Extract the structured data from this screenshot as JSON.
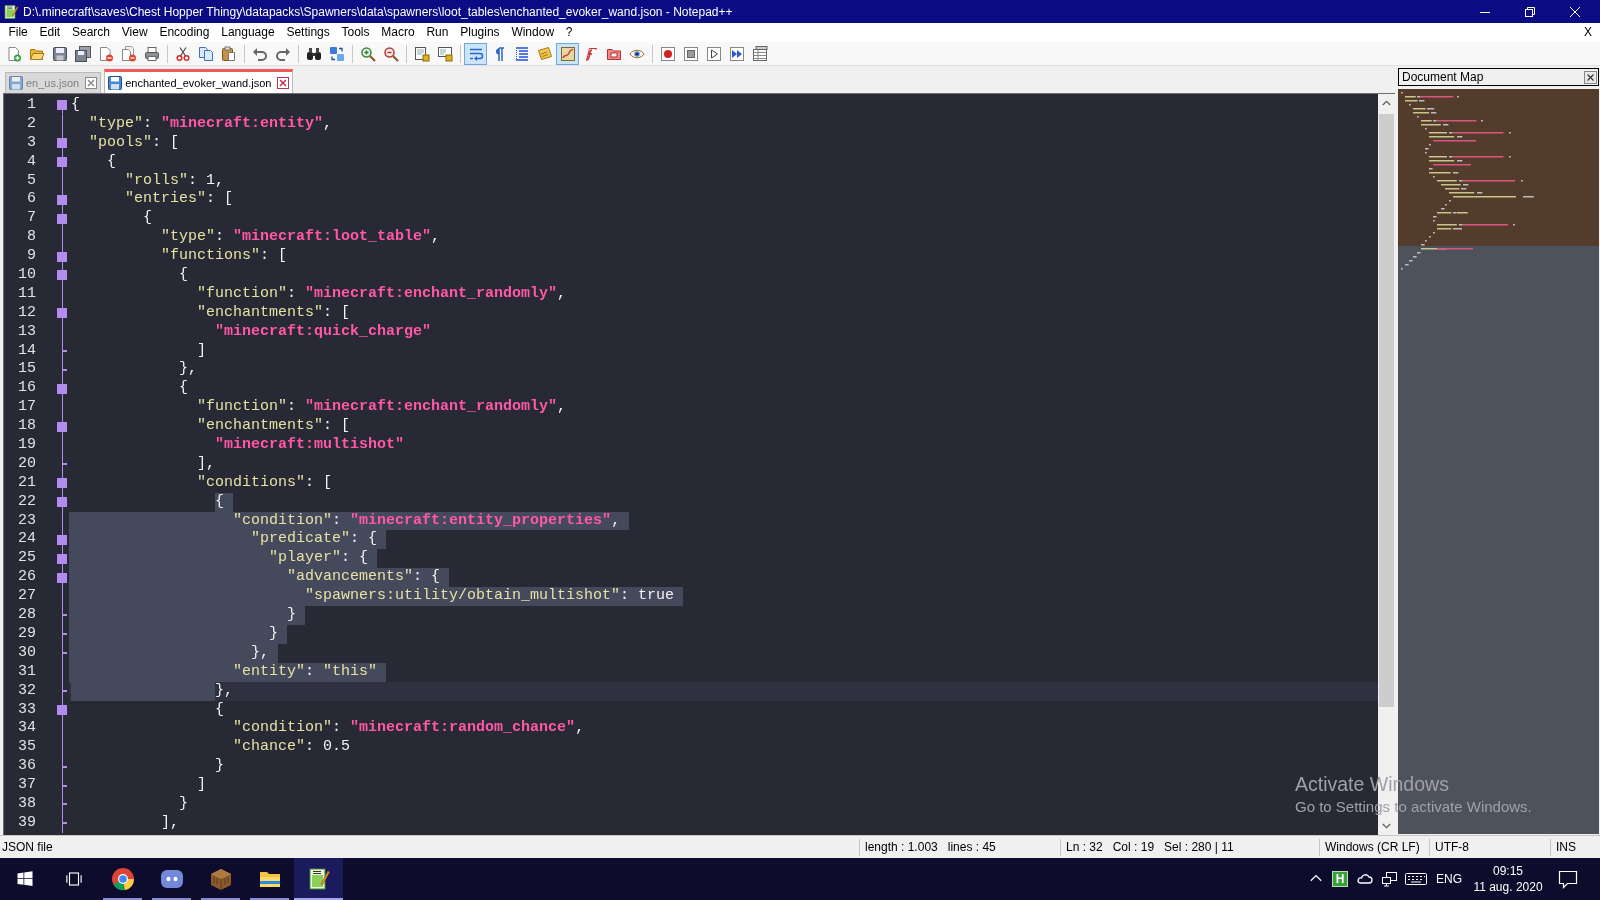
{
  "window": {
    "title": "D:\\.minecraft\\saves\\Chest Hopper Thingy\\datapacks\\Spawners\\data\\spawners\\loot_tables\\enchanted_evoker_wand.json - Notepad++"
  },
  "menu_bar": {
    "items": [
      "File",
      "Edit",
      "Search",
      "View",
      "Encoding",
      "Language",
      "Settings",
      "Tools",
      "Macro",
      "Run",
      "Plugins",
      "Window",
      "?"
    ],
    "close_glyph": "X"
  },
  "toolbar": {
    "groups": [
      [
        {
          "kind": "new",
          "pressed": false
        },
        {
          "kind": "open",
          "pressed": false
        },
        {
          "kind": "save",
          "pressed": false
        },
        {
          "kind": "saveall",
          "pressed": false
        },
        {
          "kind": "close",
          "pressed": false
        },
        {
          "kind": "closeall",
          "pressed": false
        },
        {
          "kind": "print",
          "pressed": false
        }
      ],
      [
        {
          "kind": "cut",
          "pressed": false
        },
        {
          "kind": "copy",
          "pressed": false
        },
        {
          "kind": "paste",
          "pressed": false
        }
      ],
      [
        {
          "kind": "undo",
          "pressed": false
        },
        {
          "kind": "redo",
          "pressed": false
        }
      ],
      [
        {
          "kind": "find",
          "pressed": false
        },
        {
          "kind": "replace",
          "pressed": false
        }
      ],
      [
        {
          "kind": "zoomin",
          "pressed": false
        },
        {
          "kind": "zoomout",
          "pressed": false
        }
      ],
      [
        {
          "kind": "syncv",
          "pressed": false
        },
        {
          "kind": "synch",
          "pressed": false
        }
      ],
      [
        {
          "kind": "wrap",
          "pressed": true
        },
        {
          "kind": "allchars",
          "pressed": false
        },
        {
          "kind": "indent",
          "pressed": false
        },
        {
          "kind": "udl",
          "pressed": false
        },
        {
          "kind": "docmap",
          "pressed": true
        },
        {
          "kind": "funclist",
          "pressed": false
        },
        {
          "kind": "folder",
          "pressed": false
        },
        {
          "kind": "monitor",
          "pressed": false
        }
      ],
      [
        {
          "kind": "record",
          "pressed": false
        },
        {
          "kind": "stop",
          "pressed": false
        },
        {
          "kind": "play",
          "pressed": false
        },
        {
          "kind": "playmulti",
          "pressed": false
        },
        {
          "kind": "savemacro",
          "pressed": false
        }
      ]
    ]
  },
  "tabs": [
    {
      "label": "en_us.json",
      "selected": false
    },
    {
      "label": "enchanted_evoker_wand.json",
      "selected": true
    }
  ],
  "editor": {
    "lines": [
      {
        "number": "1",
        "kind": "opener",
        "selected": false,
        "indent_selected": false,
        "current": false,
        "segments": [
          {
            "kind": "plain",
            "text": "{"
          }
        ]
      },
      {
        "number": "2",
        "kind": "inner",
        "selected": false,
        "indent_selected": false,
        "current": false,
        "segments": [
          {
            "kind": "string",
            "text": "  \"type\""
          },
          {
            "kind": "plain",
            "text": ": "
          },
          {
            "kind": "constant",
            "text": "\"minecraft:entity\""
          },
          {
            "kind": "plain",
            "text": ","
          }
        ]
      },
      {
        "number": "3",
        "kind": "opener",
        "selected": false,
        "indent_selected": false,
        "current": false,
        "segments": [
          {
            "kind": "string",
            "text": "  \"pools\""
          },
          {
            "kind": "plain",
            "text": ": ["
          }
        ]
      },
      {
        "number": "4",
        "kind": "opener",
        "selected": false,
        "indent_selected": false,
        "current": false,
        "segments": [
          {
            "kind": "plain",
            "text": "    {"
          }
        ]
      },
      {
        "number": "5",
        "kind": "inner",
        "selected": false,
        "indent_selected": false,
        "current": false,
        "segments": [
          {
            "kind": "string",
            "text": "      \"rolls\""
          },
          {
            "kind": "plain",
            "text": ": 1,"
          }
        ]
      },
      {
        "number": "6",
        "kind": "opener",
        "selected": false,
        "indent_selected": false,
        "current": false,
        "segments": [
          {
            "kind": "string",
            "text": "      \"entries\""
          },
          {
            "kind": "plain",
            "text": ": ["
          }
        ]
      },
      {
        "number": "7",
        "kind": "opener",
        "selected": false,
        "indent_selected": false,
        "current": false,
        "segments": [
          {
            "kind": "plain",
            "text": "        {"
          }
        ]
      },
      {
        "number": "8",
        "kind": "inner",
        "selected": false,
        "indent_selected": false,
        "current": false,
        "segments": [
          {
            "kind": "string",
            "text": "          \"type\""
          },
          {
            "kind": "plain",
            "text": ": "
          },
          {
            "kind": "constant",
            "text": "\"minecraft:loot_table\""
          },
          {
            "kind": "plain",
            "text": ","
          }
        ]
      },
      {
        "number": "9",
        "kind": "opener",
        "selected": false,
        "indent_selected": false,
        "current": false,
        "segments": [
          {
            "kind": "string",
            "text": "          \"functions\""
          },
          {
            "kind": "plain",
            "text": ": ["
          }
        ]
      },
      {
        "number": "10",
        "kind": "opener",
        "selected": false,
        "indent_selected": false,
        "current": false,
        "segments": [
          {
            "kind": "plain",
            "text": "            {"
          }
        ]
      },
      {
        "number": "11",
        "kind": "inner",
        "selected": false,
        "indent_selected": false,
        "current": false,
        "segments": [
          {
            "kind": "string",
            "text": "              \"function\""
          },
          {
            "kind": "plain",
            "text": ": "
          },
          {
            "kind": "constant",
            "text": "\"minecraft:enchant_randomly\""
          },
          {
            "kind": "plain",
            "text": ","
          }
        ]
      },
      {
        "number": "12",
        "kind": "opener",
        "selected": false,
        "indent_selected": false,
        "current": false,
        "segments": [
          {
            "kind": "string",
            "text": "              \"enchantments\""
          },
          {
            "kind": "plain",
            "text": ": ["
          }
        ]
      },
      {
        "number": "13",
        "kind": "inner",
        "selected": false,
        "indent_selected": false,
        "current": false,
        "segments": [
          {
            "kind": "constant",
            "text": "                \"minecraft:quick_charge\""
          }
        ]
      },
      {
        "number": "14",
        "kind": "closer",
        "selected": false,
        "indent_selected": false,
        "current": false,
        "segments": [
          {
            "kind": "plain",
            "text": "              ]"
          }
        ]
      },
      {
        "number": "15",
        "kind": "closer",
        "selected": false,
        "indent_selected": false,
        "current": false,
        "segments": [
          {
            "kind": "plain",
            "text": "            },"
          }
        ]
      },
      {
        "number": "16",
        "kind": "opener",
        "selected": false,
        "indent_selected": false,
        "current": false,
        "segments": [
          {
            "kind": "plain",
            "text": "            {"
          }
        ]
      },
      {
        "number": "17",
        "kind": "inner",
        "selected": false,
        "indent_selected": false,
        "current": false,
        "segments": [
          {
            "kind": "string",
            "text": "              \"function\""
          },
          {
            "kind": "plain",
            "text": ": "
          },
          {
            "kind": "constant",
            "text": "\"minecraft:enchant_randomly\""
          },
          {
            "kind": "plain",
            "text": ","
          }
        ]
      },
      {
        "number": "18",
        "kind": "opener",
        "selected": false,
        "indent_selected": false,
        "current": false,
        "segments": [
          {
            "kind": "string",
            "text": "              \"enchantments\""
          },
          {
            "kind": "plain",
            "text": ": ["
          }
        ]
      },
      {
        "number": "19",
        "kind": "inner",
        "selected": false,
        "indent_selected": false,
        "current": false,
        "segments": [
          {
            "kind": "constant",
            "text": "                \"minecraft:multishot\""
          }
        ]
      },
      {
        "number": "20",
        "kind": "closer",
        "selected": false,
        "indent_selected": false,
        "current": false,
        "segments": [
          {
            "kind": "plain",
            "text": "              ],"
          }
        ]
      },
      {
        "number": "21",
        "kind": "opener",
        "selected": false,
        "indent_selected": false,
        "current": false,
        "segments": [
          {
            "kind": "string",
            "text": "              \"conditions\""
          },
          {
            "kind": "plain",
            "text": ": ["
          }
        ]
      },
      {
        "number": "22",
        "kind": "opener",
        "selected": true,
        "indent_selected": false,
        "current": false,
        "segments": [
          {
            "kind": "plain",
            "text": "                {"
          }
        ]
      },
      {
        "number": "23",
        "kind": "inner",
        "selected": true,
        "indent_selected": true,
        "current": false,
        "segments": [
          {
            "kind": "string",
            "text": "                  \"condition\""
          },
          {
            "kind": "plain",
            "text": ": "
          },
          {
            "kind": "constant",
            "text": "\"minecraft:entity_properties\""
          },
          {
            "kind": "plain",
            "text": ","
          }
        ]
      },
      {
        "number": "24",
        "kind": "opener",
        "selected": true,
        "indent_selected": true,
        "current": false,
        "segments": [
          {
            "kind": "string",
            "text": "                    \"predicate\""
          },
          {
            "kind": "plain",
            "text": ": {"
          }
        ]
      },
      {
        "number": "25",
        "kind": "opener",
        "selected": true,
        "indent_selected": true,
        "current": false,
        "segments": [
          {
            "kind": "string",
            "text": "                      \"player\""
          },
          {
            "kind": "plain",
            "text": ": {"
          }
        ]
      },
      {
        "number": "26",
        "kind": "opener",
        "selected": true,
        "indent_selected": true,
        "current": false,
        "segments": [
          {
            "kind": "string",
            "text": "                        \"advancements\""
          },
          {
            "kind": "plain",
            "text": ": {"
          }
        ]
      },
      {
        "number": "27",
        "kind": "inner",
        "selected": true,
        "indent_selected": true,
        "current": false,
        "segments": [
          {
            "kind": "string",
            "text": "                          \"spawners:utility/obtain_multishot\""
          },
          {
            "kind": "plain",
            "text": ": true"
          }
        ]
      },
      {
        "number": "28",
        "kind": "closer",
        "selected": true,
        "indent_selected": true,
        "current": false,
        "segments": [
          {
            "kind": "plain",
            "text": "                        }"
          }
        ]
      },
      {
        "number": "29",
        "kind": "closer",
        "selected": true,
        "indent_selected": true,
        "current": false,
        "segments": [
          {
            "kind": "plain",
            "text": "                      }"
          }
        ]
      },
      {
        "number": "30",
        "kind": "closer",
        "selected": true,
        "indent_selected": true,
        "current": false,
        "segments": [
          {
            "kind": "plain",
            "text": "                    },"
          }
        ]
      },
      {
        "number": "31",
        "kind": "inner",
        "selected": true,
        "indent_selected": true,
        "current": false,
        "segments": [
          {
            "kind": "string",
            "text": "                  \"entity\""
          },
          {
            "kind": "plain",
            "text": ": "
          },
          {
            "kind": "string",
            "text": "\"this\""
          }
        ]
      },
      {
        "number": "32",
        "kind": "closer",
        "selected": false,
        "indent_selected": true,
        "current": true,
        "segments": [
          {
            "kind": "plain",
            "text": "                },"
          }
        ]
      },
      {
        "number": "33",
        "kind": "opener",
        "selected": false,
        "indent_selected": false,
        "current": false,
        "segments": [
          {
            "kind": "plain",
            "text": "                {"
          }
        ]
      },
      {
        "number": "34",
        "kind": "inner",
        "selected": false,
        "indent_selected": false,
        "current": false,
        "segments": [
          {
            "kind": "string",
            "text": "                  \"condition\""
          },
          {
            "kind": "plain",
            "text": ": "
          },
          {
            "kind": "constant",
            "text": "\"minecraft:random_chance\""
          },
          {
            "kind": "plain",
            "text": ","
          }
        ]
      },
      {
        "number": "35",
        "kind": "inner",
        "selected": false,
        "indent_selected": false,
        "current": false,
        "segments": [
          {
            "kind": "string",
            "text": "                  \"chance\""
          },
          {
            "kind": "plain",
            "text": ": 0.5"
          }
        ]
      },
      {
        "number": "36",
        "kind": "closer",
        "selected": false,
        "indent_selected": false,
        "current": false,
        "segments": [
          {
            "kind": "plain",
            "text": "                }"
          }
        ]
      },
      {
        "number": "37",
        "kind": "closer",
        "selected": false,
        "indent_selected": false,
        "current": false,
        "segments": [
          {
            "kind": "plain",
            "text": "              ]"
          }
        ]
      },
      {
        "number": "38",
        "kind": "closer",
        "selected": false,
        "indent_selected": false,
        "current": false,
        "segments": [
          {
            "kind": "plain",
            "text": "            }"
          }
        ]
      },
      {
        "number": "39",
        "kind": "closer",
        "selected": false,
        "indent_selected": false,
        "current": false,
        "segments": [
          {
            "kind": "plain",
            "text": "          ],"
          }
        ]
      }
    ]
  },
  "document_map": {
    "title": "Document Map"
  },
  "activation_notice": {
    "title": "Activate Windows",
    "text": "Go to Settings to activate Windows."
  },
  "status_bar": {
    "file_type": "JSON file",
    "length": "length : 1.003",
    "lines": "lines : 45",
    "line": "Ln : 32",
    "column": "Col : 19",
    "selection": "Sel : 280 | 11",
    "eol": "Windows (CR LF)",
    "encoding": "UTF-8",
    "mode": "INS"
  },
  "taskbar": {
    "apps": [
      {
        "kind": "start",
        "running": false,
        "active": false
      },
      {
        "kind": "taskview",
        "running": false,
        "active": false
      },
      {
        "kind": "browser",
        "running": true,
        "active": false
      },
      {
        "kind": "chat",
        "running": true,
        "active": false
      },
      {
        "kind": "block",
        "running": true,
        "active": false
      },
      {
        "kind": "explorer",
        "running": true,
        "active": false
      },
      {
        "kind": "notepad",
        "running": true,
        "active": true
      }
    ],
    "tray": {
      "badge": "H",
      "language": "ENG",
      "time": "09:15",
      "date": "11 aug. 2020"
    }
  }
}
